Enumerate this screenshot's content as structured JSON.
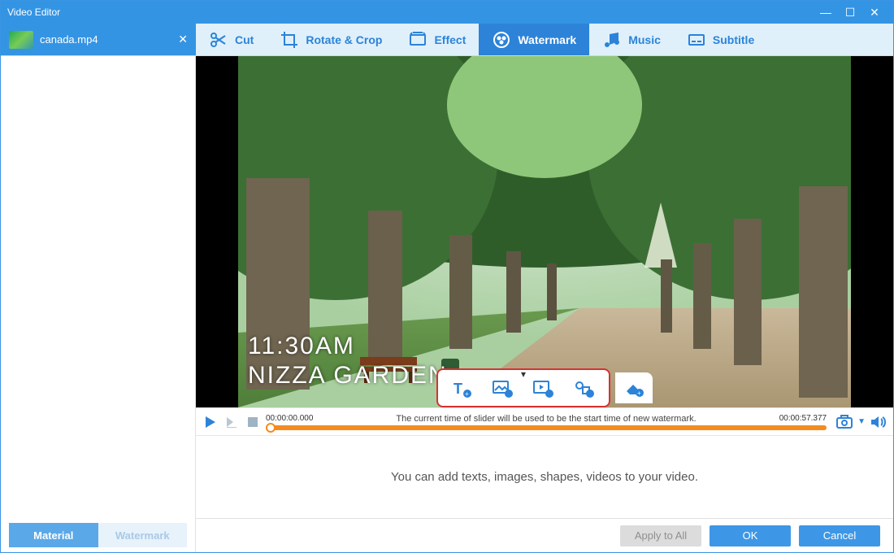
{
  "window": {
    "title": "Video Editor"
  },
  "file": {
    "name": "canada.mp4"
  },
  "tools": {
    "cut": "Cut",
    "rotate": "Rotate & Crop",
    "effect": "Effect",
    "watermark": "Watermark",
    "music": "Music",
    "subtitle": "Subtitle",
    "active": "watermark"
  },
  "sidebar": {
    "tabs": {
      "material": "Material",
      "watermark": "Watermark"
    }
  },
  "overlay": {
    "time": "11:30AM",
    "place": "NIZZA GARDEN"
  },
  "timeline": {
    "start": "00:00:00.000",
    "end": "00:00:57.377",
    "hint": "The current time of slider will be used to be the start time of new watermark."
  },
  "hint": "You can add texts, images, shapes, videos to your video.",
  "footer": {
    "apply": "Apply to All",
    "ok": "OK",
    "cancel": "Cancel"
  },
  "icons": {
    "add_text": "add-text-icon",
    "add_image": "add-image-icon",
    "add_video": "add-video-icon",
    "add_shape": "add-shape-icon",
    "eraser": "eraser-icon"
  }
}
